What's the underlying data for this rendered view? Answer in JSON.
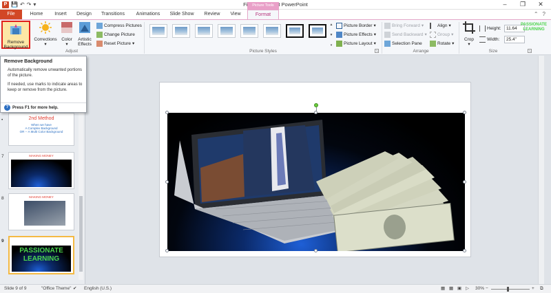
{
  "titlebar": {
    "app_letter": "P",
    "title": "Final  -  Microsoft PowerPoint",
    "context_label": "Picture Tools",
    "qat_icons": [
      "save-icon",
      "undo-icon",
      "redo-icon",
      "customize-icon"
    ]
  },
  "tabs": {
    "file": "File",
    "home": "Home",
    "insert": "Insert",
    "design": "Design",
    "transitions": "Transitions",
    "animations": "Animations",
    "slideshow": "Slide Show",
    "review": "Review",
    "view": "View",
    "format": "Format"
  },
  "ribbon": {
    "adjust": {
      "label": "Adjust",
      "remove_background": "Remove Background",
      "corrections": "Corrections",
      "color": "Color",
      "artistic_effects": "Artistic Effects",
      "compress": "Compress Pictures",
      "change": "Change Picture",
      "reset": "Reset Picture"
    },
    "styles": {
      "label": "Picture Styles",
      "border": "Picture Border",
      "effects": "Picture Effects",
      "layout": "Picture Layout"
    },
    "arrange": {
      "label": "Arrange",
      "bring_forward": "Bring Forward",
      "send_backward": "Send Backward",
      "selection_pane": "Selection Pane",
      "align": "Align",
      "group": "Group",
      "rotate": "Rotate"
    },
    "size": {
      "label": "Size",
      "crop": "Crop",
      "height_label": "Height:",
      "height_value": "11.64",
      "width_label": "Width:",
      "width_value": "25.4\""
    }
  },
  "tooltip": {
    "title": "Remove Background",
    "line1": "Automatically remove unwanted portions of the picture.",
    "line2": "If needed, use marks to indicate areas to keep or remove from the picture.",
    "help": "Press F1 for more help."
  },
  "slides": {
    "s6": {
      "title": "2nd Method",
      "l1": "When we have",
      "l2": "A Complex Background",
      "l3": "OR -- A Multi Color Background"
    },
    "s7": {
      "num": "7",
      "title": "MAKING MONEY"
    },
    "s8": {
      "num": "8",
      "title": "MAKING MONEY"
    },
    "s9": {
      "num": "9",
      "l1": "PASSIONATE",
      "l2": "LEARNING"
    }
  },
  "watermark": {
    "l1": "PASSIONATE",
    "l2": "LEARNING"
  },
  "status": {
    "slide": "Slide 9 of 9",
    "theme": "\"Office Theme\"",
    "language": "English (U.S.)",
    "zoom": "30%"
  }
}
